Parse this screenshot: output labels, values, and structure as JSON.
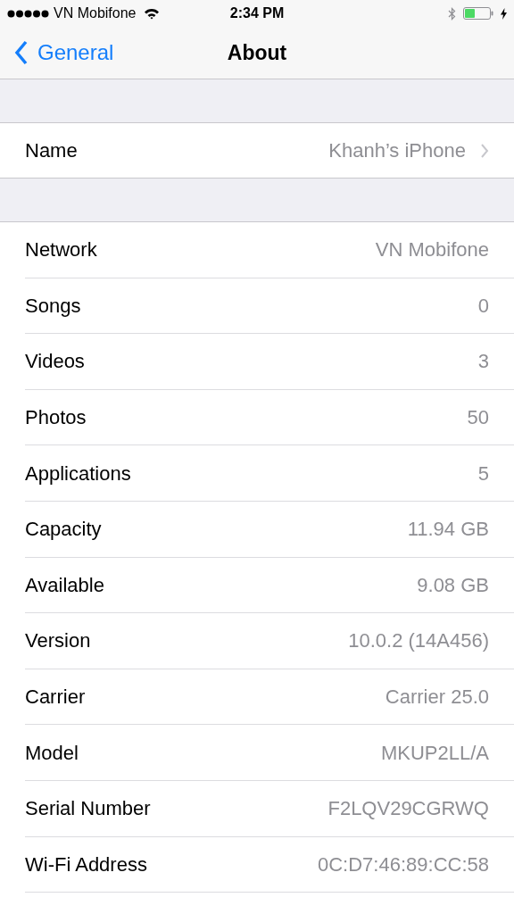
{
  "status_bar": {
    "carrier": "VN Mobifone",
    "time": "2:34 PM"
  },
  "nav": {
    "back": "General",
    "title": "About"
  },
  "name_row": {
    "label": "Name",
    "value": "Khanh’s iPhone"
  },
  "rows": [
    {
      "label": "Network",
      "value": "VN Mobifone"
    },
    {
      "label": "Songs",
      "value": "0"
    },
    {
      "label": "Videos",
      "value": "3"
    },
    {
      "label": "Photos",
      "value": "50"
    },
    {
      "label": "Applications",
      "value": "5"
    },
    {
      "label": "Capacity",
      "value": "11.94 GB"
    },
    {
      "label": "Available",
      "value": "9.08 GB"
    },
    {
      "label": "Version",
      "value": "10.0.2 (14A456)"
    },
    {
      "label": "Carrier",
      "value": "Carrier 25.0"
    },
    {
      "label": "Model",
      "value": "MKUP2LL/A"
    },
    {
      "label": "Serial Number",
      "value": "F2LQV29CGRWQ"
    },
    {
      "label": "Wi-Fi Address",
      "value": "0C:D7:46:89:CC:58"
    }
  ]
}
